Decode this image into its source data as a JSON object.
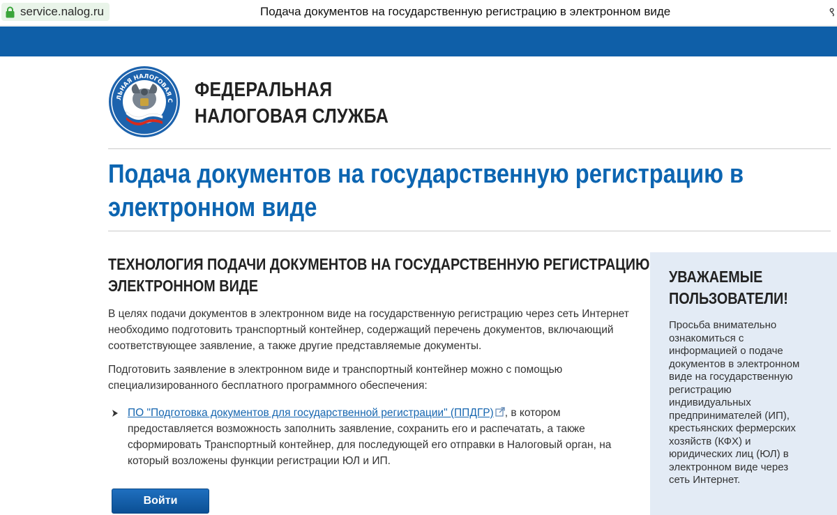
{
  "browser": {
    "url": "service.nalog.ru",
    "tab_title": "Подача документов на государственную регистрацию в электронном виде",
    "menu_glyph": "९"
  },
  "header": {
    "org_name_line1": "ФЕДЕРАЛЬНАЯ",
    "org_name_line2": "НАЛОГОВАЯ СЛУЖБА",
    "emblem_text": "ФЕДЕРАЛЬНАЯ НАЛОГОВАЯ СЛУЖБА"
  },
  "page_title": {
    "line1": "Подача документов на государственную регистрацию в",
    "line2": "электронном виде"
  },
  "main": {
    "section_title_line1": "ТЕХНОЛОГИЯ ПОДАЧИ ДОКУМЕНТОВ НА ГОСУДАРСТВЕННУЮ РЕГИСТРАЦИЮ В",
    "section_title_line2": "ЭЛЕКТРОННОМ ВИДЕ",
    "para1": [
      "В целях подачи документов в электронном виде на государственную регистрацию через сеть Интернет",
      "необходимо подготовить транспортный контейнер, содержащий перечень документов, включающий",
      "соответствующее заявление, а также другие представляемые документы."
    ],
    "para2": [
      "Подготовить заявление в электронном виде и транспортный контейнер можно с помощью",
      "специализированного бесплатного программного обеспечения:"
    ],
    "bullet": {
      "link_text": "ПО \"Подготовка документов для государственной регистрации\" (ППДГР)",
      "line1_tail": ", в котором",
      "lines": [
        "предоставляется возможность заполнить заявление, сохранить его и распечатать, а также",
        "сформировать Транспортный контейнер, для последующей его отправки в Налоговый орган, на",
        "который возложены функции регистрации ЮЛ и ИП."
      ]
    },
    "login_label": "Войти"
  },
  "notice": {
    "title_line1": "УВАЖАЕМЫЕ",
    "title_line2": "ПОЛЬЗОВАТЕЛИ!",
    "lines": [
      "Просьба внимательно",
      "ознакомиться с",
      "информацией о подаче",
      "документов в электронном",
      "виде на государственную",
      "регистрацию",
      "индивидуальных",
      "предпринимателей (ИП),",
      "крестьянских фермерских",
      "хозяйств (КФХ) и",
      "юридических лиц (ЮЛ) в",
      "электронном виде через",
      "сеть Интернет."
    ]
  },
  "colors": {
    "brand_blue": "#0f5fa8",
    "title_blue": "#0c65b1",
    "link_blue": "#1666b0",
    "notice_bg": "#e3ebf5",
    "secure_chip": "#e9f4e9",
    "lock_green": "#3aa53a"
  },
  "icons": [
    "lock-icon",
    "fns-emblem",
    "arrow-right-icon",
    "external-link-icon"
  ]
}
